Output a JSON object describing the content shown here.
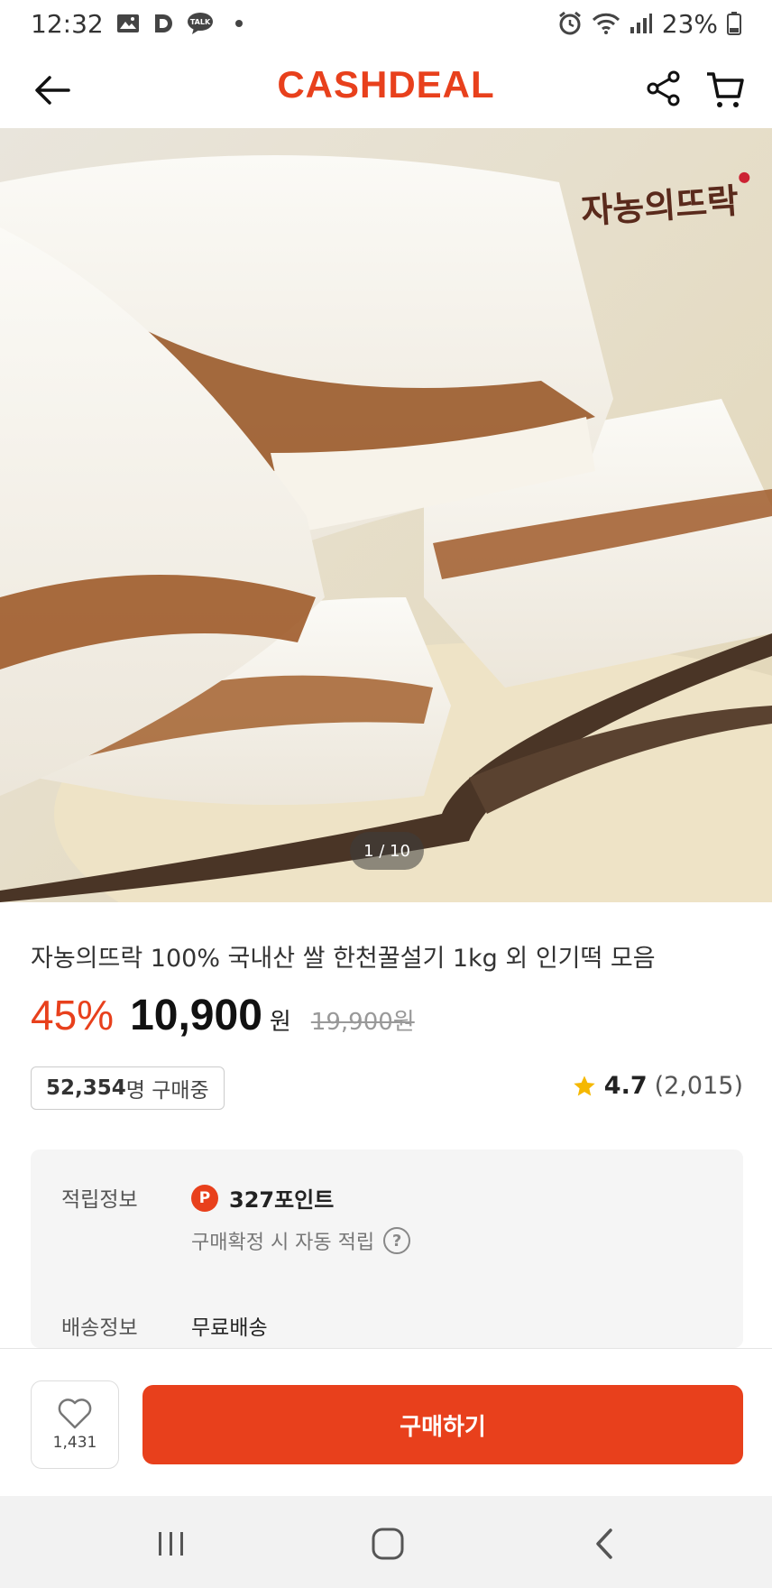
{
  "status_bar": {
    "time": "12:32",
    "battery": "23%",
    "icons": [
      "gallery-icon",
      "d-app-icon",
      "talk-icon",
      "alarm-icon",
      "wifi-icon",
      "signal-icon",
      "battery-icon"
    ]
  },
  "header": {
    "brand": "CASHDEAL",
    "brand_color": "#e8401c",
    "icons": [
      "back-arrow-icon",
      "share-icon",
      "cart-icon"
    ]
  },
  "hero": {
    "counter": "1 / 10",
    "brand_stamp": "자농의뜨락"
  },
  "product": {
    "title": "자농의뜨락 100% 국내산 쌀 한천꿀설기 1kg 외 인기떡 모음",
    "discount": "45%",
    "price": "10,900",
    "currency": "원",
    "original_price": "19,900원",
    "buyers_count": "52,354",
    "buyers_suffix": "명 구매중",
    "rating": "4.7",
    "review_count": "(2,015)"
  },
  "info": {
    "points_label": "적립정보",
    "points_badge": "P",
    "points_value": "327포인트",
    "points_note": "구매확정 시 자동 적립",
    "help_icon": "?",
    "shipping_label": "배송정보",
    "shipping_value": "무료배송"
  },
  "bottom": {
    "like_count": "1,431",
    "buy_label": "구매하기"
  },
  "nav": {
    "icons": [
      "recent-apps-icon",
      "home-icon",
      "back-icon"
    ]
  }
}
